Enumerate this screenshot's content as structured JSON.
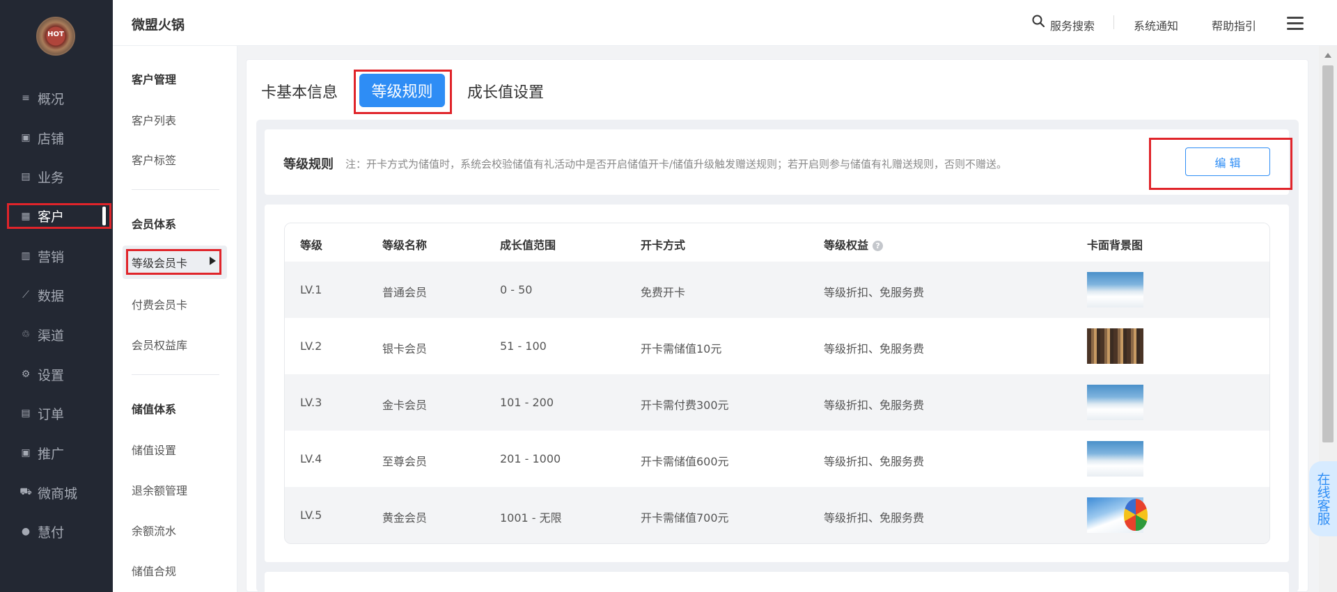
{
  "app": {
    "brand": "微盟火锅",
    "logo_text": "HOT"
  },
  "leftnav": [
    {
      "label": "概况",
      "icon": "overview-icon",
      "glyph": "≡"
    },
    {
      "label": "店铺",
      "icon": "store-icon",
      "glyph": "▣"
    },
    {
      "label": "业务",
      "icon": "business-icon",
      "glyph": "▤"
    },
    {
      "label": "客户",
      "icon": "vip-card-icon",
      "glyph": "▦"
    },
    {
      "label": "营销",
      "icon": "marketing-icon",
      "glyph": "▥"
    },
    {
      "label": "数据",
      "icon": "data-icon",
      "glyph": "⟋"
    },
    {
      "label": "渠道",
      "icon": "channel-icon",
      "glyph": "♲"
    },
    {
      "label": "设置",
      "icon": "settings-icon",
      "glyph": "⚙"
    },
    {
      "label": "订单",
      "icon": "order-icon",
      "glyph": "▤"
    },
    {
      "label": "推广",
      "icon": "promotion-icon",
      "glyph": "▣"
    },
    {
      "label": "微商城",
      "icon": "shop-cart-icon",
      "glyph": "⛟"
    },
    {
      "label": "慧付",
      "icon": "pay-icon",
      "glyph": "●"
    }
  ],
  "subnav": {
    "customer_head": "客户管理",
    "customer_list": "客户列表",
    "customer_tags": "客户标签",
    "member_head": "会员体系",
    "level_card": "等级会员卡",
    "paid_card": "付费会员卡",
    "rights_lib": "会员权益库",
    "stored_head": "储值体系",
    "stored_settings": "储值设置",
    "refund_mgmt": "退余额管理",
    "balance_flow": "余额流水",
    "stored_compliance": "储值合规"
  },
  "topbar": {
    "search": "服务搜索",
    "notice": "系统通知",
    "help": "帮助指引"
  },
  "tabs": {
    "basic": "卡基本信息",
    "level_rules": "等级规则",
    "growth": "成长值设置"
  },
  "rules": {
    "title": "等级规则",
    "note": "注：开卡方式为储值时，系统会校验储值有礼活动中是否开启储值开卡/储值升级触发赠送规则；若开启则参与储值有礼赠送规则，否则不赠送。",
    "edit": "编 辑"
  },
  "table": {
    "headers": {
      "level": "等级",
      "name": "等级名称",
      "range": "成长值范围",
      "method": "开卡方式",
      "benefits": "等级权益",
      "bg": "卡面背景图"
    },
    "rows": [
      {
        "level": "LV.1",
        "name": "普通会员",
        "range": "0 - 50",
        "method": "免费开卡",
        "benefits": "等级折扣、免服务费",
        "bg": "sky"
      },
      {
        "level": "LV.2",
        "name": "银卡会员",
        "range": "51 - 100",
        "method": "开卡需储值10元",
        "benefits": "等级折扣、免服务费",
        "bg": "crowd"
      },
      {
        "level": "LV.3",
        "name": "金卡会员",
        "range": "101 - 200",
        "method": "开卡需付费300元",
        "benefits": "等级折扣、免服务费",
        "bg": "sky"
      },
      {
        "level": "LV.4",
        "name": "至尊会员",
        "range": "201 - 1000",
        "method": "开卡需储值600元",
        "benefits": "等级折扣、免服务费",
        "bg": "sky"
      },
      {
        "level": "LV.5",
        "name": "黄金会员",
        "range": "1001 - 无限",
        "method": "开卡需储值700元",
        "benefits": "等级折扣、免服务费",
        "bg": "balloon"
      }
    ]
  },
  "kefu": "在线客服",
  "colors": {
    "nav_bg": "#232833",
    "accent": "#2e8df5",
    "highlight": "#e0242a"
  }
}
